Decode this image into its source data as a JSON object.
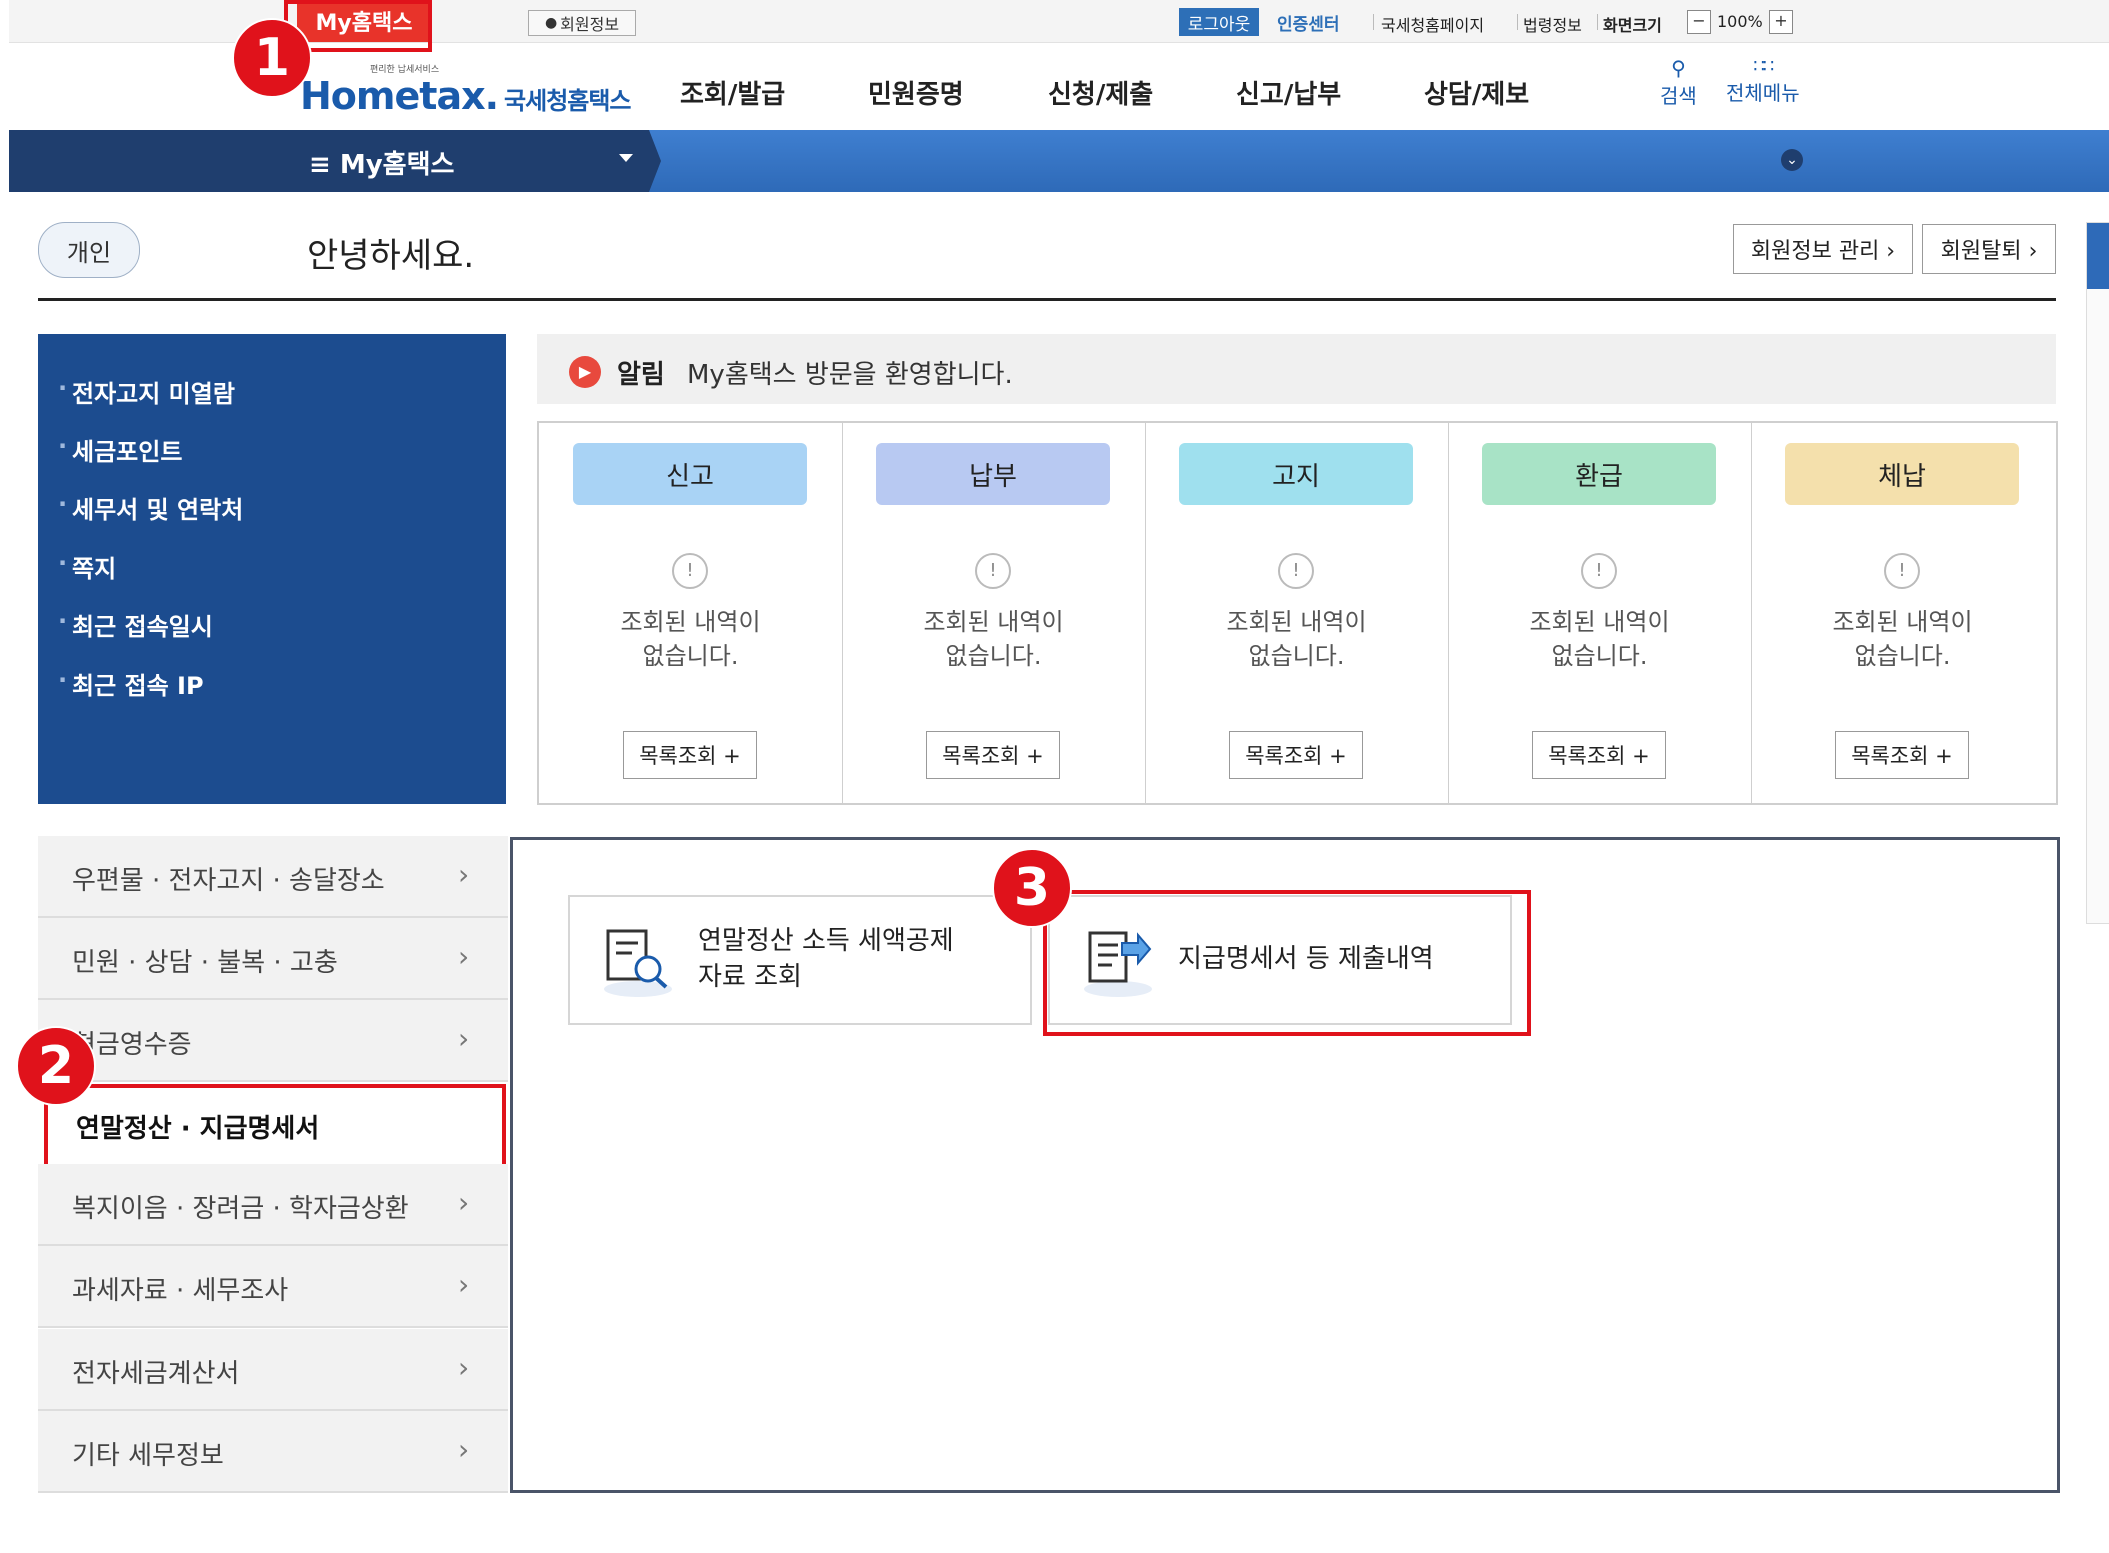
{
  "util": {
    "my_hometax": "My홈택스",
    "member_info": "회원정보",
    "logout": "로그아웃",
    "cert_center": "인증센터",
    "nts_home": "국세청홈페이지",
    "law_info": "법령정보",
    "screen_size": "화면크기",
    "zoom_minus": "−",
    "zoom_level": "100%",
    "zoom_plus": "+"
  },
  "logo": {
    "tagline": "편리한 납세서비스",
    "name": "Hometax.",
    "kr": "국세청홈택스"
  },
  "nav": [
    "조회/발급",
    "민원증명",
    "신청/제출",
    "신고/납부",
    "상담/제보"
  ],
  "header_icons": {
    "search": "검색",
    "all_menu": "전체메뉴"
  },
  "band": {
    "menu_label": "≡  My홈택스"
  },
  "greeting": {
    "type_pill": "개인",
    "hello": "안녕하세요.",
    "manage_btn": "회원정보 관리 ›",
    "withdraw_btn": "회원탈퇴 ›"
  },
  "blue_panel": [
    "전자고지 미열람",
    "세금포인트",
    "세무서 및 연락처",
    "쪽지",
    "최근 접속일시",
    "최근 접속 IP"
  ],
  "notice": {
    "label": "알림",
    "message": "My홈택스 방문을 환영합니다."
  },
  "cards": [
    {
      "title": "신고",
      "color": "#a9d3f5",
      "empty": "조회된 내역이\n없습니다.",
      "button": "목록조회 +"
    },
    {
      "title": "납부",
      "color": "#b8c9f2",
      "empty": "조회된 내역이\n없습니다.",
      "button": "목록조회 +"
    },
    {
      "title": "고지",
      "color": "#9fe0ee",
      "empty": "조회된 내역이\n없습니다.",
      "button": "목록조회 +"
    },
    {
      "title": "환급",
      "color": "#a8e3c6",
      "empty": "조회된 내역이\n없습니다.",
      "button": "목록조회 +"
    },
    {
      "title": "체납",
      "color": "#f4e0ac",
      "empty": "조회된 내역이\n없습니다.",
      "button": "목록조회 +"
    }
  ],
  "left_menu": [
    "우편물 · 전자고지 · 송달장소",
    "민원 · 상담 · 불복 · 고충",
    "현금영수증",
    "연말정산 · 지급명세서",
    "복지이음 · 장려금 · 학자금상환",
    "과세자료 · 세무조사",
    "전자세금계산서",
    "기타 세무정보"
  ],
  "tiles": [
    {
      "label": "연말정산 소득 세액공제\n자료 조회",
      "icon": "receipt-search-icon"
    },
    {
      "label": "지급명세서 등 제출내역",
      "icon": "document-submit-icon"
    }
  ],
  "badges": [
    "1",
    "2",
    "3"
  ],
  "colors": {
    "accent_red": "#e0121b",
    "nav_blue": "#2e6ab8",
    "panel_blue": "#1c4c8f"
  }
}
